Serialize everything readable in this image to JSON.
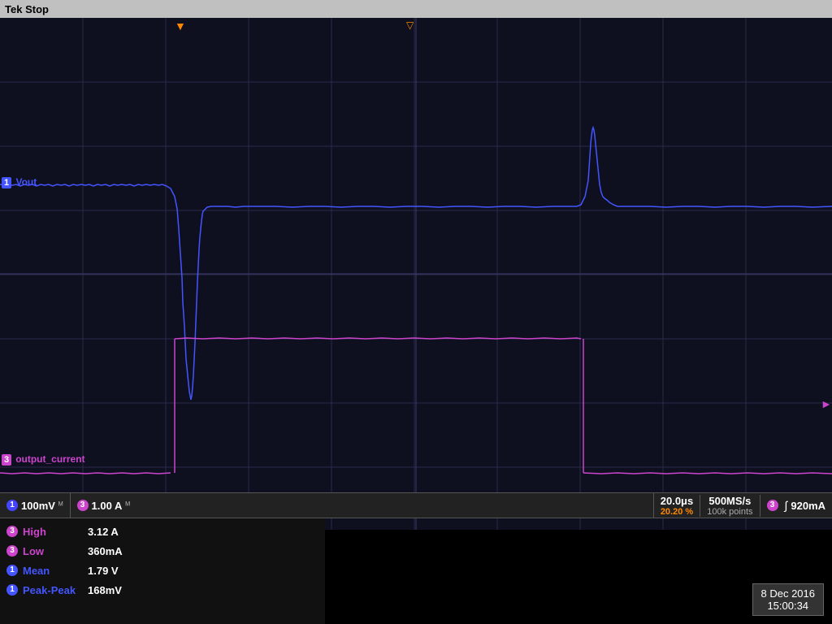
{
  "header": {
    "brand": "Tek",
    "status": "Stop"
  },
  "channels": {
    "ch1": {
      "number": "1",
      "label": "Vout",
      "color": "#4455ff",
      "scale": "100mV",
      "scale_symbol": "ᴹ"
    },
    "ch3": {
      "number": "3",
      "label": "output_current",
      "color": "#cc44cc",
      "scale": "1.00 A",
      "scale_symbol": "ᴹ"
    }
  },
  "timebase": {
    "time_div": "20.0μs",
    "duty_cycle": "20.20 %",
    "sample_rate": "500MS/s",
    "record_length": "100k points"
  },
  "trigger": {
    "type": "∫",
    "level": "920mA",
    "ch_number": "3"
  },
  "measurements": [
    {
      "ch": "3",
      "color": "#cc44cc",
      "label": "High",
      "value": "3.12 A"
    },
    {
      "ch": "3",
      "color": "#cc44cc",
      "label": "Low",
      "value": "360mA"
    },
    {
      "ch": "1",
      "color": "#4455ff",
      "label": "Mean",
      "value": "1.79 V"
    },
    {
      "ch": "1",
      "color": "#4455ff",
      "label": "Peak-Peak",
      "value": "168mV"
    }
  ],
  "datetime": {
    "date": "8 Dec 2016",
    "time": "15:00:34"
  },
  "grid": {
    "cols": 10,
    "rows": 8,
    "bg_color": "#0a0a1e"
  },
  "trigger_markers": {
    "position1": "▼",
    "position2": "▽"
  }
}
